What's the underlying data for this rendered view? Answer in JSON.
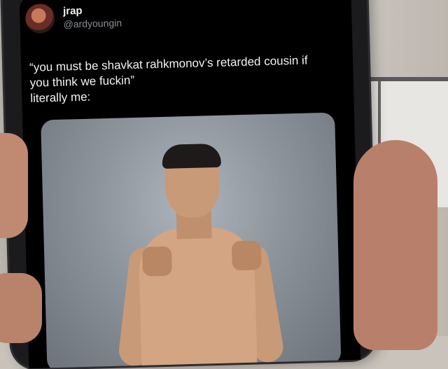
{
  "tweet": {
    "display_name": "jrap",
    "handle": "@ardyoungin",
    "text_lines": [
      "“you must be shavkat rahkmonov’s retarded cousin if",
      "you think we fuckin”",
      "literally me:"
    ]
  },
  "media": {
    "subject": "shirtless fighter posing with fists raised"
  },
  "colors": {
    "screen_background": "#000000",
    "text_primary": "#f3f3f3",
    "text_secondary": "#8b8f94"
  }
}
